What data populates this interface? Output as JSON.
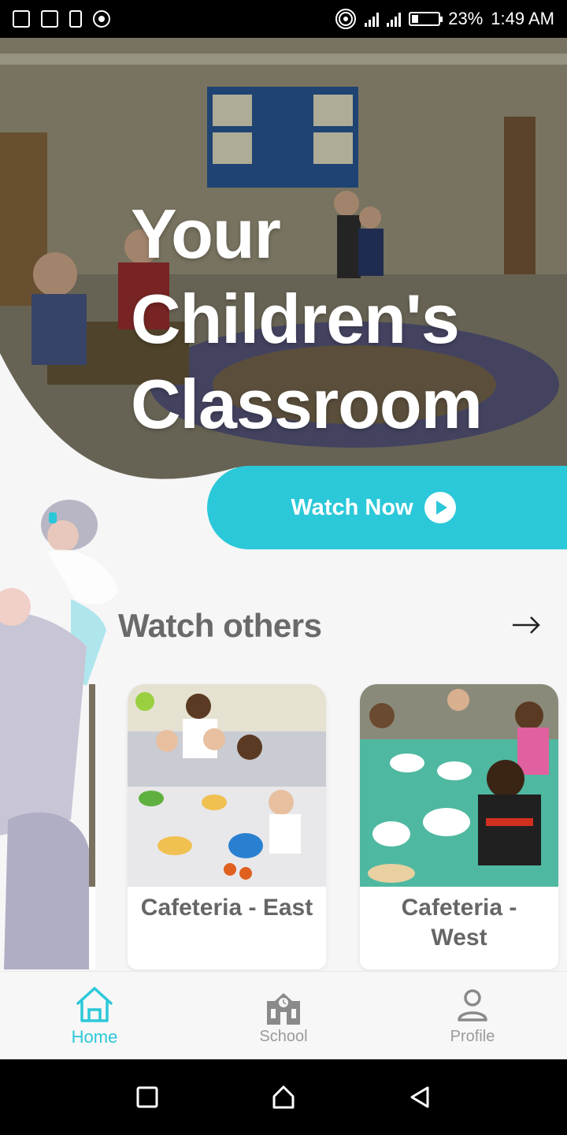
{
  "status_bar": {
    "battery_percent": "23%",
    "time": "1:49 AM",
    "left_icons": [
      "image-icon",
      "activity-icon",
      "download-icon",
      "record-icon"
    ],
    "right_icons": [
      "hotspot-icon",
      "signal-icon",
      "signal-icon",
      "battery-icon"
    ],
    "battery_level": 0.23
  },
  "hero": {
    "title_line1": "Your",
    "title_line2": "Children's",
    "title_line3": "Classroom",
    "watch_button_label": "Watch Now",
    "accent_color": "#2bc8d9"
  },
  "section": {
    "title": "Watch others"
  },
  "cards": [
    {
      "label": "Cafeteria - East"
    },
    {
      "label": "Cafeteria - West"
    }
  ],
  "bottom_nav": {
    "items": [
      {
        "label": "Home",
        "icon": "home-icon",
        "active": true
      },
      {
        "label": "School",
        "icon": "school-icon",
        "active": false
      },
      {
        "label": "Profile",
        "icon": "profile-icon",
        "active": false
      }
    ]
  },
  "system_nav": {
    "icons": [
      "recents-icon",
      "home-circle-icon",
      "back-icon"
    ]
  }
}
